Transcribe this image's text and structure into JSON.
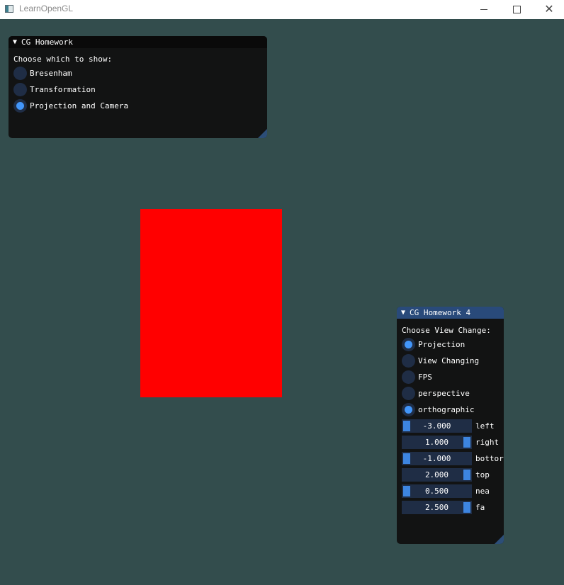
{
  "window": {
    "title": "LearnOpenGL",
    "controls": {
      "minimize": "minimize-icon",
      "maximize": "maximize-icon",
      "close": "close-icon"
    }
  },
  "scene": {
    "quad_color": "#ff0000",
    "background": "#334d4d"
  },
  "panel1": {
    "title": "CG Homework",
    "prompt": "Choose which to show:",
    "options": [
      {
        "label": "Bresenham",
        "checked": false
      },
      {
        "label": "Transformation",
        "checked": false
      },
      {
        "label": "Projection and Camera",
        "checked": true
      }
    ]
  },
  "panel2": {
    "title": "CG Homework 4",
    "prompt": "Choose View Change:",
    "options": [
      {
        "label": "Projection",
        "checked": true
      },
      {
        "label": "View Changing",
        "checked": false
      },
      {
        "label": "FPS",
        "checked": false
      },
      {
        "label": "perspective",
        "checked": false
      },
      {
        "label": "orthographic",
        "checked": true
      }
    ],
    "sliders": [
      {
        "label": "left",
        "value": "-3.000",
        "fraction": 0
      },
      {
        "label": "right",
        "value": "1.000",
        "fraction": 1
      },
      {
        "label": "bottor",
        "value": "-1.000",
        "fraction": 0
      },
      {
        "label": "top",
        "value": "2.000",
        "fraction": 1
      },
      {
        "label": "nea",
        "value": "0.500",
        "fraction": 0
      },
      {
        "label": "fa",
        "value": "2.500",
        "fraction": 1
      }
    ]
  }
}
